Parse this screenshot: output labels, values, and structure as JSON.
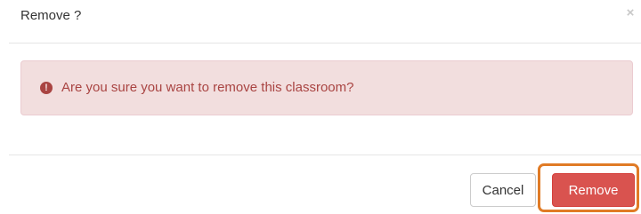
{
  "modal": {
    "title": "Remove ?",
    "close_glyph": "×",
    "alert": {
      "icon": "exclamation-circle-icon",
      "icon_glyph": "!",
      "message": "Are you sure you want to remove this classroom?"
    },
    "footer": {
      "cancel_label": "Cancel",
      "remove_label": "Remove"
    }
  },
  "colors": {
    "danger": "#d9534f",
    "alert_bg": "#f2dede",
    "alert_text": "#a94442",
    "focus_highlight": "#e07b26"
  }
}
